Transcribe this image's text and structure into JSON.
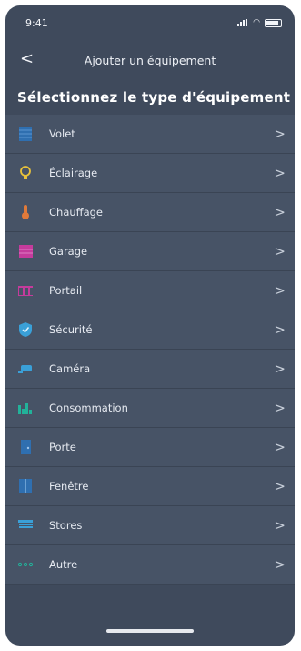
{
  "status": {
    "time": "9:41"
  },
  "nav": {
    "back": "<",
    "title": "Ajouter un équipement"
  },
  "headline": "Sélectionnez le type d'équipement",
  "items": [
    {
      "label": "Volet",
      "icon": "shutter-icon",
      "color": "#2f6fb0"
    },
    {
      "label": "Éclairage",
      "icon": "lightbulb-icon",
      "color": "#e9c23a"
    },
    {
      "label": "Chauffage",
      "icon": "thermometer-icon",
      "color": "#e07a3a"
    },
    {
      "label": "Garage",
      "icon": "garage-door-icon",
      "color": "#c53b9c"
    },
    {
      "label": "Portail",
      "icon": "gate-icon",
      "color": "#c53b9c"
    },
    {
      "label": "Sécurité",
      "icon": "shield-icon",
      "color": "#3aa0d8"
    },
    {
      "label": "Caméra",
      "icon": "camera-icon",
      "color": "#3aa0d8"
    },
    {
      "label": "Consommation",
      "icon": "bar-chart-icon",
      "color": "#22b29a"
    },
    {
      "label": "Porte",
      "icon": "door-icon",
      "color": "#2f6fb0"
    },
    {
      "label": "Fenêtre",
      "icon": "window-icon",
      "color": "#2f6fb0"
    },
    {
      "label": "Stores",
      "icon": "blinds-icon",
      "color": "#3aa0d8"
    },
    {
      "label": "Autre",
      "icon": "more-dots-icon",
      "color": "#22b29a"
    }
  ],
  "chevron": ">"
}
